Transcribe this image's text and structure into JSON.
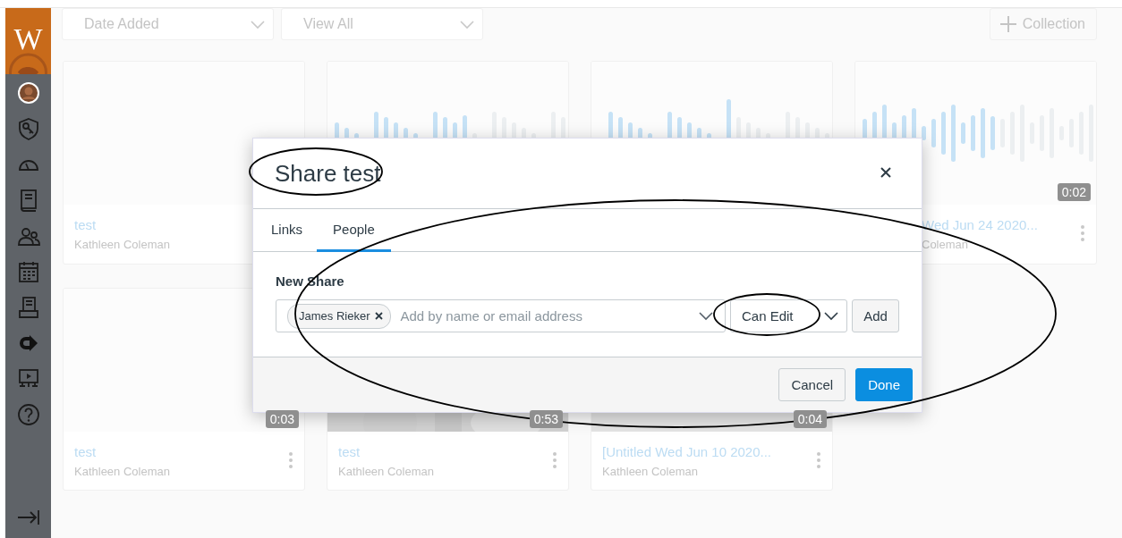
{
  "sidebar": {
    "logo": "W"
  },
  "toolbar": {
    "sort": "Date Added",
    "filter": "View All",
    "collection_button": "Collection"
  },
  "cards": [
    {
      "kind": "blank",
      "title": "test",
      "author": "Kathleen Coleman"
    },
    {
      "kind": "waveform"
    },
    {
      "kind": "waveform"
    },
    {
      "kind": "waveform",
      "duration": "0:02",
      "title": "Wed Jun 24 2020...",
      "author": "Coleman",
      "covered": true,
      "more_menu": true
    },
    {
      "kind": "blank",
      "duration": "0:03",
      "title": "test",
      "author": "Kathleen Coleman",
      "covered": false,
      "more_menu": true
    },
    {
      "kind": "picture",
      "duration": "0:53",
      "title": "test",
      "author": "Kathleen Coleman",
      "covered": false,
      "more_menu": true
    },
    {
      "kind": "shade",
      "duration": "0:04",
      "title": "[Untitled Wed Jun 10 2020...",
      "author": "Kathleen Coleman",
      "covered": false,
      "more_menu": true
    }
  ],
  "dialog": {
    "title": "Share test",
    "tabs": [
      {
        "label": "Links",
        "selected": false
      },
      {
        "label": "People",
        "selected": true
      }
    ],
    "section_label": "New Share",
    "chips": [
      {
        "label": "James Rieker"
      }
    ],
    "placeholder": "Add by name or email address",
    "permission": "Can Edit",
    "add_button": "Add",
    "buttons": [
      {
        "label": "Cancel",
        "kind": "secondary"
      },
      {
        "label": "Done",
        "kind": "primary"
      }
    ]
  }
}
